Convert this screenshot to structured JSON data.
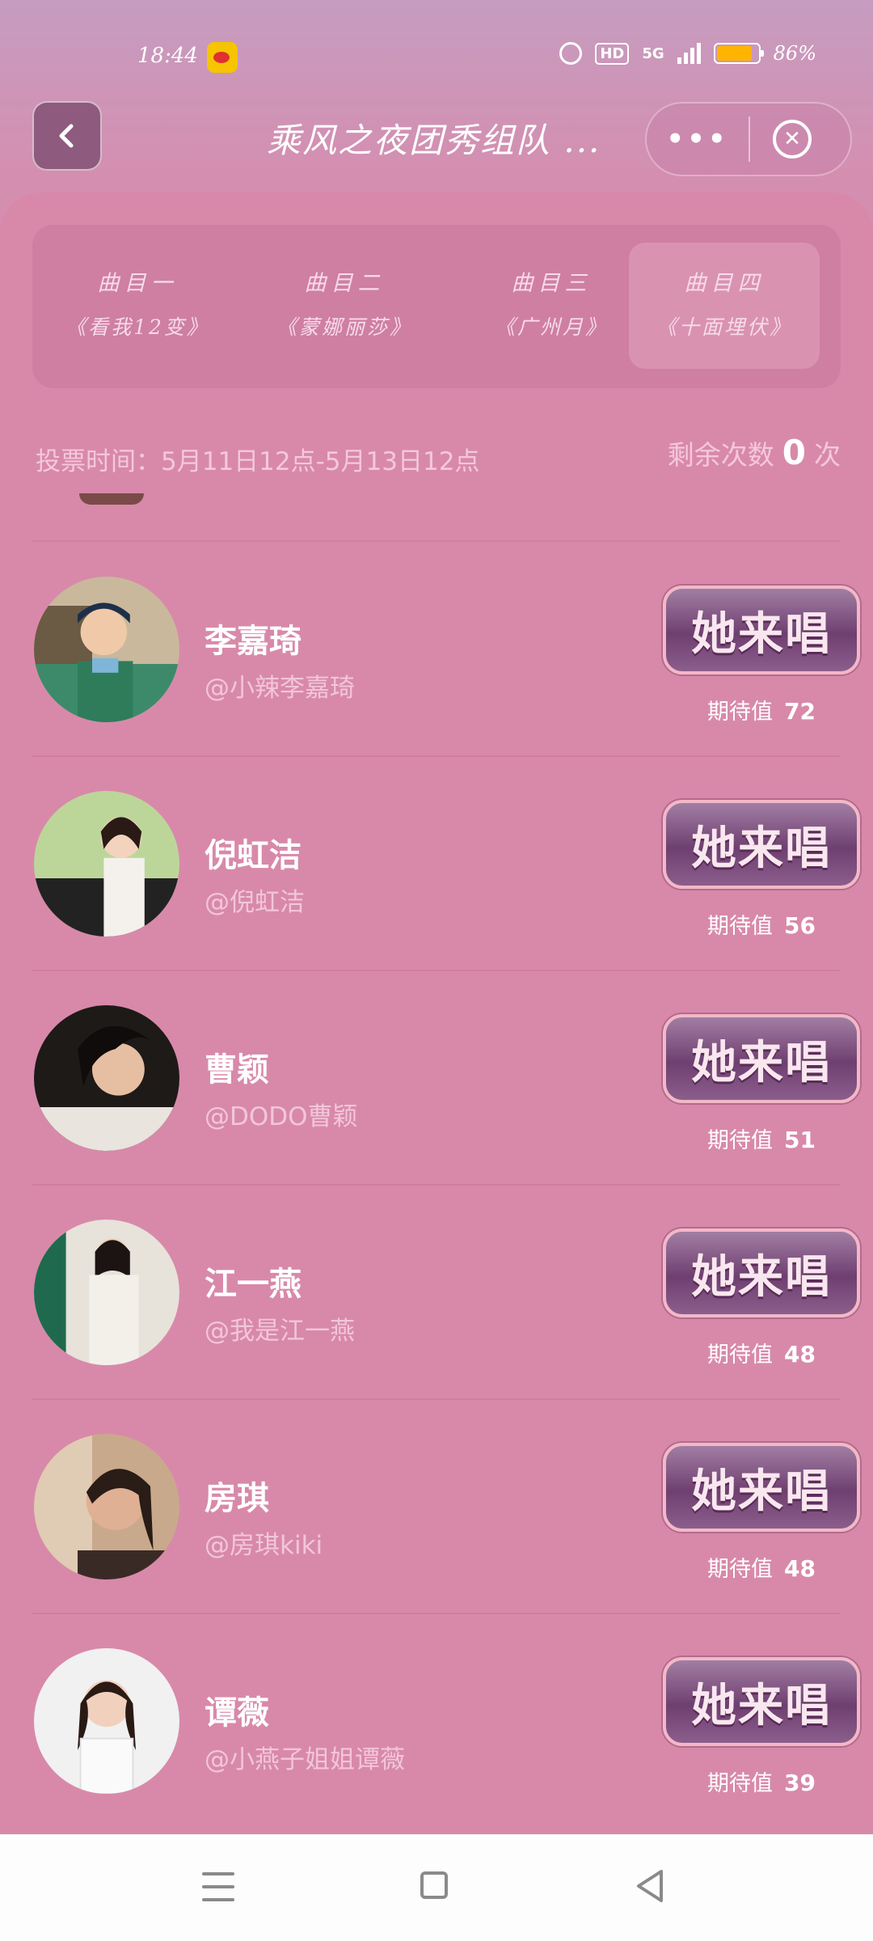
{
  "status_bar": {
    "time": "18:44",
    "network": "5G",
    "battery_percent": "86%",
    "battery_level": 0.86
  },
  "header": {
    "title": "乘风之夜团秀组队 ...",
    "more_label": "•••",
    "close_label": "✕"
  },
  "tabs": [
    {
      "label": "曲目一",
      "song": "《看我12变》",
      "active": false
    },
    {
      "label": "曲目二",
      "song": "《蒙娜丽莎》",
      "active": false
    },
    {
      "label": "曲目三",
      "song": "《广州月》",
      "active": false
    },
    {
      "label": "曲目四",
      "song": "《十面埋伏》",
      "active": true
    }
  ],
  "vote": {
    "time_text": "投票时间：5月11日12点-5月13日12点",
    "remaining_label": "剩余次数",
    "remaining_count": "0",
    "remaining_unit": "次"
  },
  "button_label": "她来唱",
  "expect_label": "期待值",
  "candidates": [
    {
      "name": "李嘉琦",
      "handle": "@小辣李嘉琦",
      "expect": "72"
    },
    {
      "name": "倪虹洁",
      "handle": "@倪虹洁",
      "expect": "56"
    },
    {
      "name": "曹颖",
      "handle": "@DODO曹颖",
      "expect": "51"
    },
    {
      "name": "江一燕",
      "handle": "@我是江一燕",
      "expect": "48"
    },
    {
      "name": "房琪",
      "handle": "@房琪kiki",
      "expect": "48"
    },
    {
      "name": "谭薇",
      "handle": "@小燕子姐姐谭薇",
      "expect": "39"
    }
  ],
  "colors": {
    "background": "#d889a9",
    "button_purple": "#6e3f70",
    "accent_pink": "#f2b8c8"
  }
}
